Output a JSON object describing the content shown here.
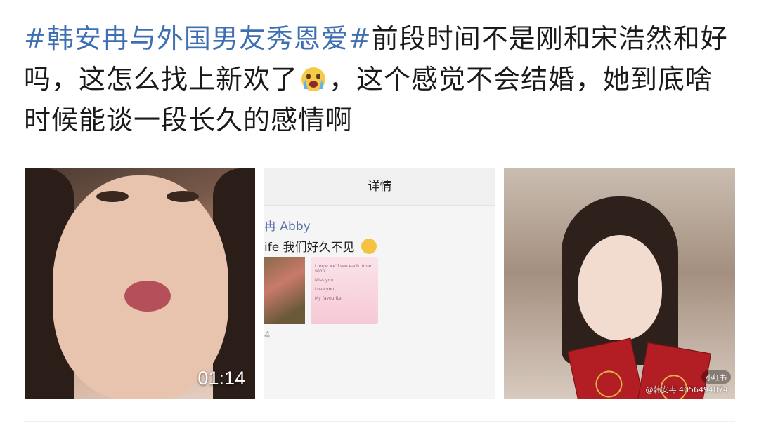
{
  "post": {
    "hashtag": "#韩安冉与外国男友秀恩爱#",
    "text_part1": "前段时间不是刚和宋浩然和好吗，这怎么找上新欢了",
    "emoji_name": "crying-face-icon",
    "text_part2": "，这个感觉不会结婚，她到底啥时候能谈一段长久的感情啊"
  },
  "media": {
    "video": {
      "duration": "01:14"
    },
    "chat_screenshot": {
      "header": "详情",
      "name": "冉 Abby",
      "message": "ife 我们好久不见",
      "card_lines": [
        "I hope we'll see each other soon",
        "Miss you",
        "Love you",
        "My favourite"
      ],
      "count": "4"
    },
    "photo": {
      "watermark_logo": "小红书",
      "watermark_text": "@韩安冉 4056494874"
    }
  },
  "colors": {
    "hashtag": "#3f6fb3",
    "text": "#1a1a1a"
  }
}
